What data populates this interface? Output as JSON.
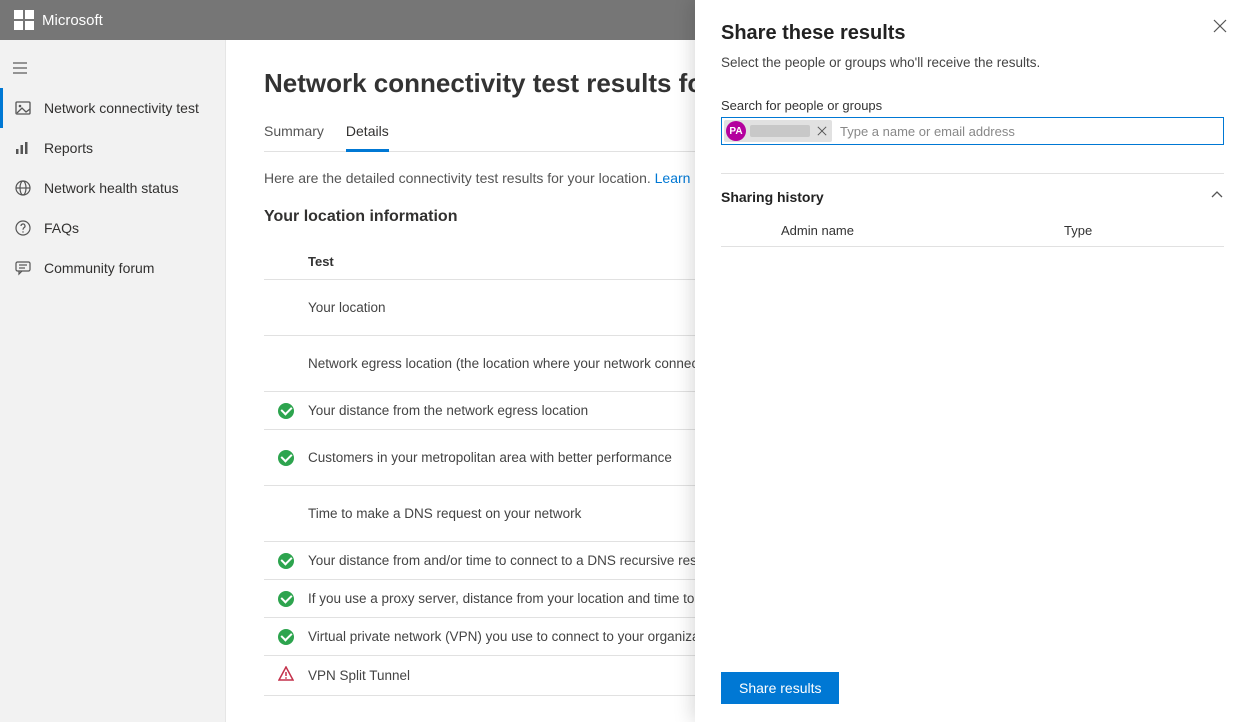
{
  "brand": "Microsoft",
  "sidebar": {
    "items": [
      {
        "label": "Network connectivity test",
        "icon": "image-icon",
        "active": true
      },
      {
        "label": "Reports",
        "icon": "chart-icon",
        "active": false
      },
      {
        "label": "Network health status",
        "icon": "globe-icon",
        "active": false
      },
      {
        "label": "FAQs",
        "icon": "help-icon",
        "active": false
      },
      {
        "label": "Community forum",
        "icon": "chat-icon",
        "active": false
      }
    ]
  },
  "page": {
    "title": "Network connectivity test results for you",
    "tabs": {
      "summary": "Summary",
      "details": "Details"
    },
    "intro_text": "Here are the detailed connectivity test results for your location. ",
    "intro_link": "Learn about the tests w",
    "section_title": "Your location information",
    "table_header": "Test",
    "rows": [
      {
        "status": "",
        "text": "Your location",
        "tall": true
      },
      {
        "status": "",
        "text": "Network egress location (the location where your network connects to you",
        "tall": true
      },
      {
        "status": "ok",
        "text": "Your distance from the network egress location",
        "tall": false
      },
      {
        "status": "ok",
        "text": "Customers in your metropolitan area with better performance",
        "tall": true
      },
      {
        "status": "",
        "text": "Time to make a DNS request on your network",
        "tall": true
      },
      {
        "status": "ok",
        "text": "Your distance from and/or time to connect to a DNS recursive resolver",
        "tall": false
      },
      {
        "status": "ok",
        "text": "If you use a proxy server, distance from your location and time to connect",
        "tall": false
      },
      {
        "status": "ok",
        "text": "Virtual private network (VPN) you use to connect to your organization",
        "tall": false
      },
      {
        "status": "warn",
        "text": "VPN Split Tunnel",
        "tall": false
      }
    ]
  },
  "panel": {
    "title": "Share these results",
    "subtitle": "Select the people or groups who'll receive the results.",
    "search_label": "Search for people or groups",
    "search_placeholder": "Type a name or email address",
    "chip_initials": "PA",
    "history_title": "Sharing history",
    "history_cols": {
      "admin": "Admin name",
      "type": "Type"
    },
    "share_button": "Share results"
  }
}
